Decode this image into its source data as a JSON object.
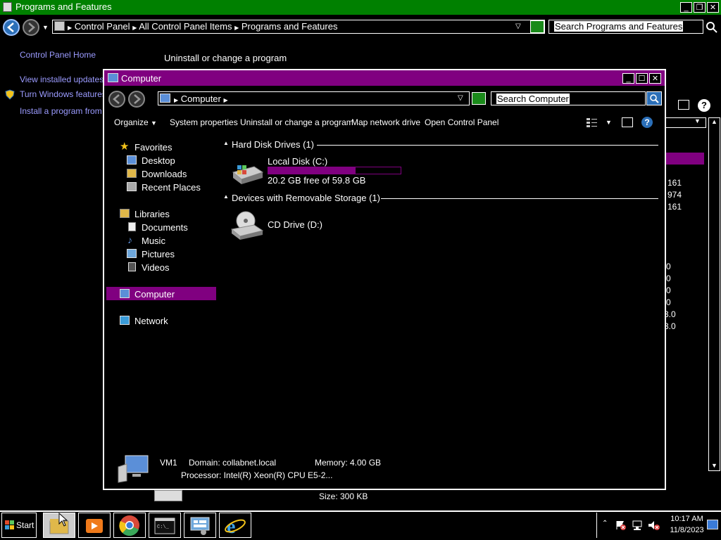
{
  "back_window": {
    "title": "Programs and Features",
    "breadcrumb": [
      "Control Panel",
      "All Control Panel Items",
      "Programs and Features"
    ],
    "search_placeholder": "Search Programs and Features",
    "sidebar": {
      "home": "Control Panel Home",
      "view_updates": "View installed updates",
      "windows_features": "Turn Windows features o",
      "install_network": "Install a program from the"
    },
    "heading": "Uninstall or change a program",
    "visible_values": [
      "161",
      "974",
      "161",
      "0",
      "0",
      "0",
      "0",
      "3.0",
      "3.0"
    ],
    "size_label": "Size: 300 KB"
  },
  "computer_window": {
    "title": "Computer",
    "address": "Computer",
    "search_placeholder": "Search Computer",
    "toolbar": {
      "organize": "Organize",
      "system_properties": "System properties",
      "uninstall": "Uninstall or change a program",
      "map_drive": "Map network drive",
      "open_control_panel": "Open Control Panel"
    },
    "nav": {
      "favorites": "Favorites",
      "desktop": "Desktop",
      "downloads": "Downloads",
      "recent_places": "Recent Places",
      "libraries": "Libraries",
      "documents": "Documents",
      "music": "Music",
      "pictures": "Pictures",
      "videos": "Videos",
      "computer": "Computer",
      "network": "Network"
    },
    "groups": {
      "hard_disk": "Hard Disk Drives (1)",
      "removable": "Devices with Removable Storage (1)"
    },
    "drives": {
      "local_disk_name": "Local Disk (C:)",
      "local_disk_free": "20.2 GB free of 59.8 GB",
      "local_disk_used_fraction": 0.66,
      "cd_drive_name": "CD Drive (D:)"
    },
    "details": {
      "computer_name": "VM1",
      "domain": "Domain: collabnet.local",
      "memory": "Memory: 4.00 GB",
      "processor": "Processor: Intel(R) Xeon(R) CPU E5-2..."
    }
  },
  "taskbar": {
    "start_label": "Start",
    "time": "10:17 AM",
    "date": "11/8/2023"
  },
  "colors": {
    "back_titlebar": "#008000",
    "accent_purple": "#800080",
    "link": "#9b9bff"
  }
}
